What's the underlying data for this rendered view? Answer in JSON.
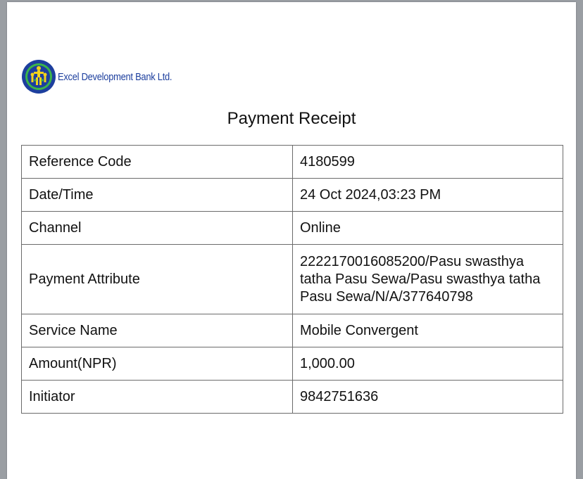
{
  "brand": {
    "name": "Excel Development Bank Ltd.",
    "logo_icon": "bank-logo-emblem",
    "colors": {
      "primary_blue": "#1d3f9e",
      "accent_yellow": "#f2d21b",
      "accent_green": "#3bb54a"
    }
  },
  "receipt": {
    "title": "Payment Receipt",
    "rows": [
      {
        "label": "Reference Code",
        "value": "4180599"
      },
      {
        "label": "Date/Time",
        "value": "24 Oct 2024,03:23 PM"
      },
      {
        "label": "Channel",
        "value": "Online"
      },
      {
        "label": "Payment Attribute",
        "value": "2222170016085200/Pasu swasthya tatha Pasu Sewa/Pasu swasthya tatha Pasu Sewa/N/A/377640798"
      },
      {
        "label": "Service Name",
        "value": "Mobile Convergent"
      },
      {
        "label": "Amount(NPR)",
        "value": "1,000.00"
      },
      {
        "label": "Initiator",
        "value": "9842751636"
      }
    ]
  }
}
